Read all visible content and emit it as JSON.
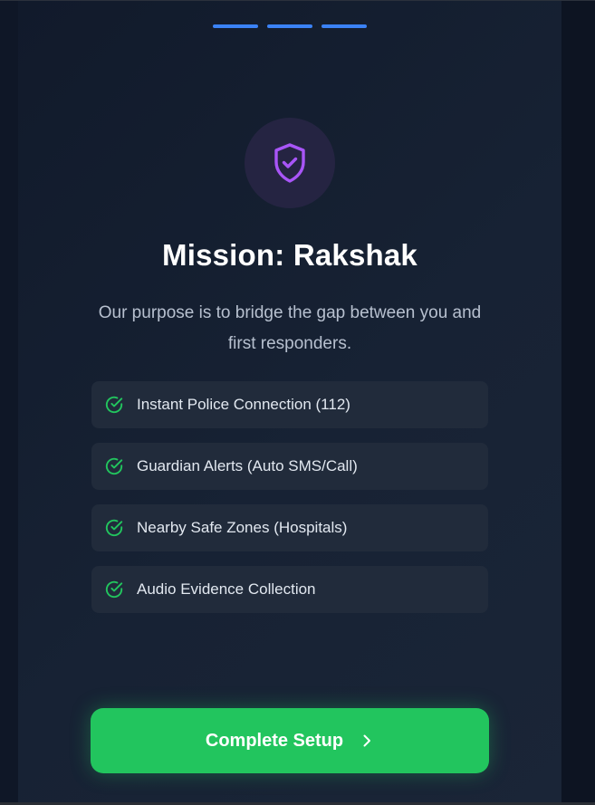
{
  "progress": {
    "total_steps": 3,
    "completed_steps": 3,
    "accent": "#3b82f6"
  },
  "header": {
    "icon": "shield-check-icon",
    "title": "Mission: Rakshak",
    "description": "Our purpose is to bridge the gap between you and first responders."
  },
  "features": [
    {
      "icon": "check-circle-icon",
      "label": "Instant Police Connection (112)"
    },
    {
      "icon": "check-circle-icon",
      "label": "Guardian Alerts (Auto SMS/Call)"
    },
    {
      "icon": "check-circle-icon",
      "label": "Nearby Safe Zones (Hospitals)"
    },
    {
      "icon": "check-circle-icon",
      "label": "Audio Evidence Collection"
    }
  ],
  "cta": {
    "label": "Complete Setup",
    "icon": "chevron-right-icon"
  },
  "colors": {
    "background": "#0e1524",
    "panel": "#172234",
    "shield_purple": "#a855f7",
    "check_green": "#22c55e",
    "cta_green": "#22c55e",
    "progress_blue": "#3b82f6"
  }
}
